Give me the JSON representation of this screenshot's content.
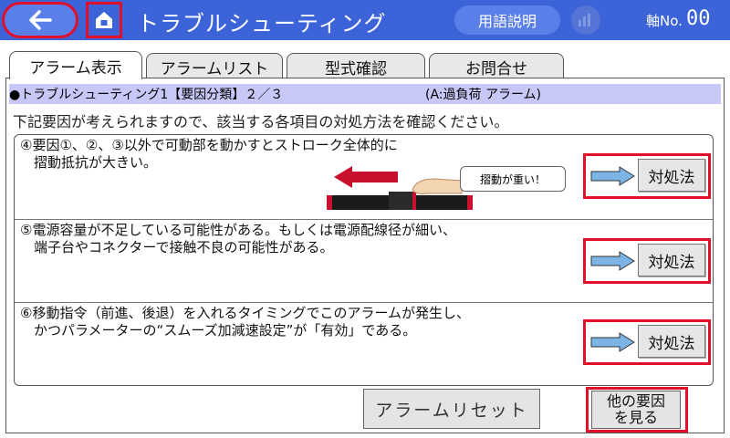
{
  "header": {
    "title": "トラブルシューティング",
    "glossary_label": "用語説明",
    "axis_label": "軸No.",
    "axis_number": "00"
  },
  "tabs": [
    {
      "label": "アラーム表示",
      "active": true
    },
    {
      "label": "アラームリスト",
      "active": false
    },
    {
      "label": "型式確認",
      "active": false
    },
    {
      "label": "お問合せ",
      "active": false
    }
  ],
  "subheader": {
    "text": "●トラブルシューティング1【要因分類】２／３",
    "mode": "(A:過負荷 アラーム)"
  },
  "intro": "下記要因が考えられますので、該当する各項目の対処方法を確認ください。",
  "causes": [
    {
      "line1": "④要因①、②、③以外で可動部を動かすとストローク全体的に",
      "line2": "　摺動抵抗が大きい。",
      "remedy_label": "対処法"
    },
    {
      "line1": "⑤電源容量が不足している可能性がある。もしくは電源配線径が細い、",
      "line2": "　端子台やコネクターで接触不良の可能性がある。",
      "remedy_label": "対処法"
    },
    {
      "line1": "⑥移動指令（前進、後退）を入れるタイミングでこのアラームが発生し、",
      "line2": "　かつパラメーターの“スムーズ加減速設定”が「有効」である。",
      "remedy_label": "対処法"
    }
  ],
  "illustration": {
    "bubble_text": "摺動が重い！"
  },
  "footer": {
    "reset_label": "アラームリセット",
    "other_line1": "他の要因",
    "other_line2": "を見る"
  },
  "colors": {
    "header_bg": "#3d63d9",
    "highlight": "#e0102a",
    "subheader_bg": "#c8c8f8",
    "arrow_fill": "#7cb4e6"
  }
}
